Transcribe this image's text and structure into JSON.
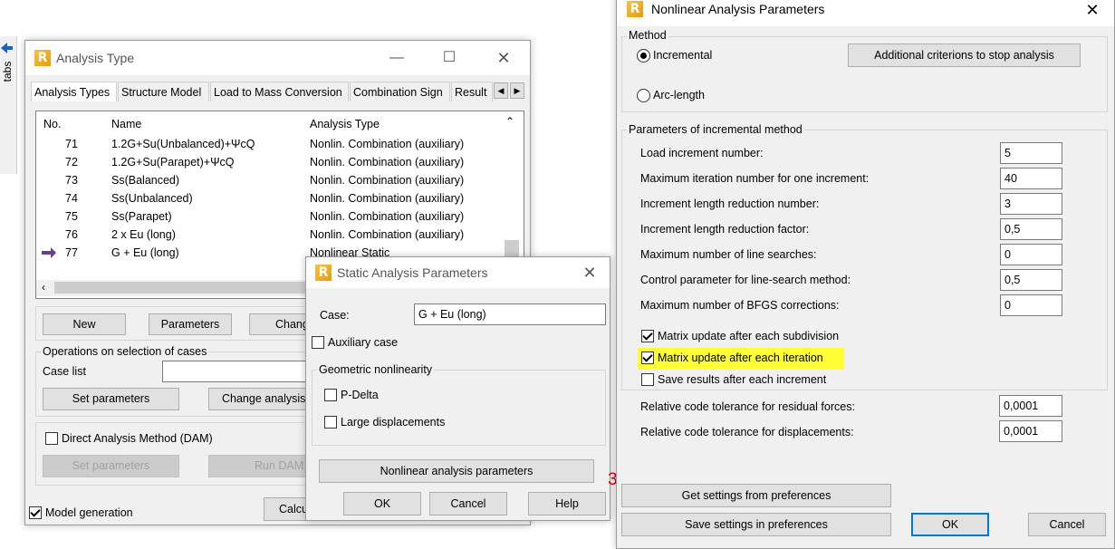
{
  "side_panel": {
    "label": "tabs"
  },
  "analysis_type": {
    "title": "Analysis Type",
    "tabs": [
      "Analysis Types",
      "Structure Model",
      "Load to Mass Conversion",
      "Combination Sign",
      "Result"
    ],
    "columns": [
      "No.",
      "Name",
      "Analysis Type"
    ],
    "rows": [
      {
        "no": "71",
        "name": "1.2G+Su(Unbalanced)+ΨcQ",
        "type": "Nonlin. Combination (auxiliary)"
      },
      {
        "no": "72",
        "name": "1.2G+Su(Parapet)+ΨcQ",
        "type": "Nonlin. Combination (auxiliary)"
      },
      {
        "no": "73",
        "name": "Ss(Balanced)",
        "type": "Nonlin. Combination (auxiliary)"
      },
      {
        "no": "74",
        "name": "Ss(Unbalanced)",
        "type": "Nonlin. Combination (auxiliary)"
      },
      {
        "no": "75",
        "name": "Ss(Parapet)",
        "type": "Nonlin. Combination (auxiliary)"
      },
      {
        "no": "76",
        "name": "2 x Eu (long)",
        "type": "Nonlin. Combination (auxiliary)"
      },
      {
        "no": "77",
        "name": "G + Eu (long)",
        "type": "Nonlinear Static"
      }
    ],
    "new_label": "New",
    "parameters_label": "Parameters",
    "change_label": "Chang",
    "ops_group": "Operations on selection of cases",
    "case_list_label": "Case list",
    "set_params_label": "Set parameters",
    "change_analysis_label": "Change analysis",
    "dam_label": "Direct Analysis Method (DAM)",
    "dam_set_params": "Set parameters",
    "run_dam": "Run DAM",
    "model_gen_label": "Model generation",
    "calc_label": "Calcu"
  },
  "static_params": {
    "title": "Static Analysis Parameters",
    "case_label": "Case:",
    "case_value": "G + Eu (long)",
    "aux_case": "Auxiliary case",
    "geo_group": "Geometric nonlinearity",
    "pdelta": "P-Delta",
    "large_disp": "Large displacements",
    "nonlinear_btn": "Nonlinear analysis parameters",
    "ok": "OK",
    "cancel": "Cancel",
    "help": "Help"
  },
  "stray_digit": "3",
  "nonlinear_params": {
    "title": "Nonlinear Analysis Parameters",
    "method_group": "Method",
    "incremental": "Incremental",
    "arc_length": "Arc-length",
    "additional_btn": "Additional criterions to stop analysis",
    "incr_group": "Parameters of incremental method",
    "fields": [
      {
        "label": "Load increment number:",
        "value": "5"
      },
      {
        "label": "Maximum iteration number for one increment:",
        "value": "40"
      },
      {
        "label": "Increment length reduction number:",
        "value": "3"
      },
      {
        "label": "Increment length reduction factor:",
        "value": "0,5"
      },
      {
        "label": "Maximum number of line searches:",
        "value": "0"
      },
      {
        "label": "Control parameter for line-search method:",
        "value": "0,5"
      },
      {
        "label": "Maximum number of BFGS corrections:",
        "value": "0"
      }
    ],
    "matrix_subdivision": "Matrix update after each subdivision",
    "matrix_iteration": "Matrix update after each iteration",
    "save_results": "Save results after each increment",
    "tol_forces_label": "Relative code tolerance for residual forces:",
    "tol_forces_value": "0,0001",
    "tol_disp_label": "Relative code tolerance for displacements:",
    "tol_disp_value": "0,0001",
    "get_settings": "Get settings from preferences",
    "save_settings": "Save settings in preferences",
    "ok": "OK",
    "cancel": "Cancel",
    "highlight_color": "#ffff33"
  }
}
